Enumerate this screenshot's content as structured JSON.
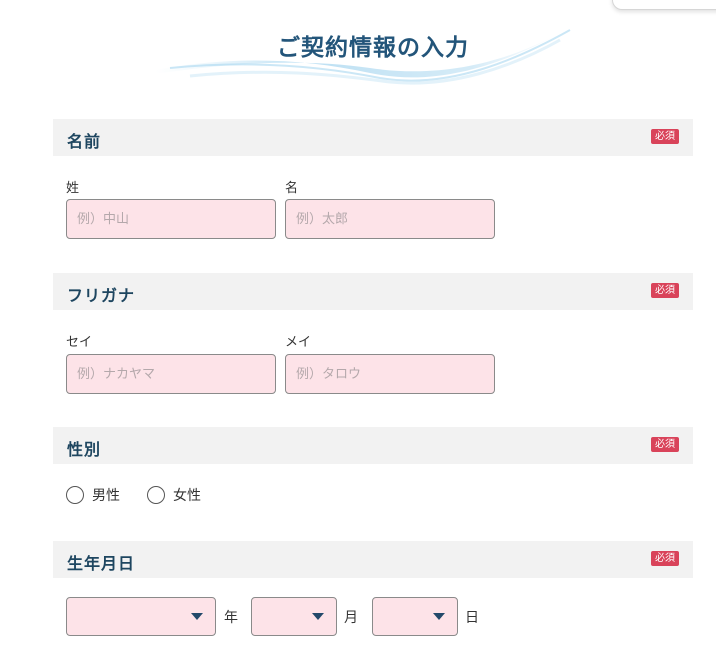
{
  "header": {
    "title": "ご契約情報の入力"
  },
  "sections": {
    "name": {
      "title": "名前",
      "required_label": "必須",
      "last_label": "姓",
      "last_placeholder": "例）中山",
      "first_label": "名",
      "first_placeholder": "例）太郎"
    },
    "furigana": {
      "title": "フリガナ",
      "required_label": "必須",
      "last_label": "セイ",
      "last_placeholder": "例）ナカヤマ",
      "first_label": "メイ",
      "first_placeholder": "例）タロウ"
    },
    "gender": {
      "title": "性別",
      "required_label": "必須",
      "options": [
        "男性",
        "女性"
      ]
    },
    "birthday": {
      "title": "生年月日",
      "required_label": "必須",
      "year_unit": "年",
      "month_unit": "月",
      "day_unit": "日"
    }
  },
  "colors": {
    "title": "#23557a",
    "input_bg": "#fde3e8",
    "badge": "#d9435a",
    "section_bg": "#f2f2f2"
  },
  "icons": {
    "select_caret": "chevron-down-icon",
    "hero_decoration": "wave-brush-icon"
  }
}
